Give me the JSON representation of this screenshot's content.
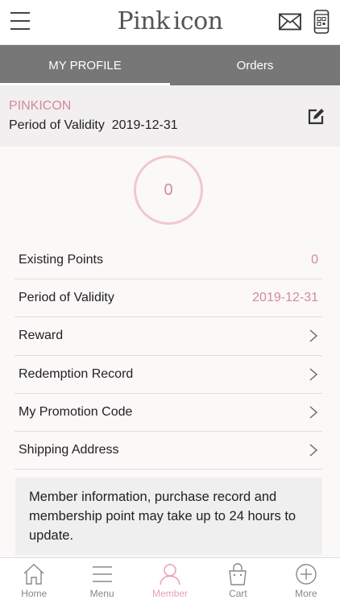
{
  "topbar": {
    "logo_left": "Pink",
    "logo_right": "icon"
  },
  "tabs": [
    {
      "label": "MY PROFILE",
      "active": true
    },
    {
      "label": "Orders",
      "active": false
    }
  ],
  "profile": {
    "brand": "PINKICON",
    "validity_label": "Period of Validity",
    "validity_date": "2019-12-31",
    "points_display": "0"
  },
  "list": [
    {
      "label": "Existing Points",
      "value": "0"
    },
    {
      "label": "Period of Validity",
      "value": "2019-12-31"
    },
    {
      "label": "Reward"
    },
    {
      "label": "Redemption Record"
    },
    {
      "label": "My Promotion Code"
    },
    {
      "label": "Shipping Address"
    }
  ],
  "notice": "Member information, purchase record and membership point may take up to 24 hours to update.",
  "bottomnav": [
    {
      "label": "Home",
      "icon": "home-icon"
    },
    {
      "label": "Menu",
      "icon": "menu-icon"
    },
    {
      "label": "Member",
      "icon": "member-icon",
      "active": true
    },
    {
      "label": "Cart",
      "icon": "cart-icon"
    },
    {
      "label": "More",
      "icon": "more-icon"
    }
  ],
  "colors": {
    "accent": "#d58a9c",
    "tabbar": "#777777",
    "active_nav": "#e8a0b0"
  }
}
